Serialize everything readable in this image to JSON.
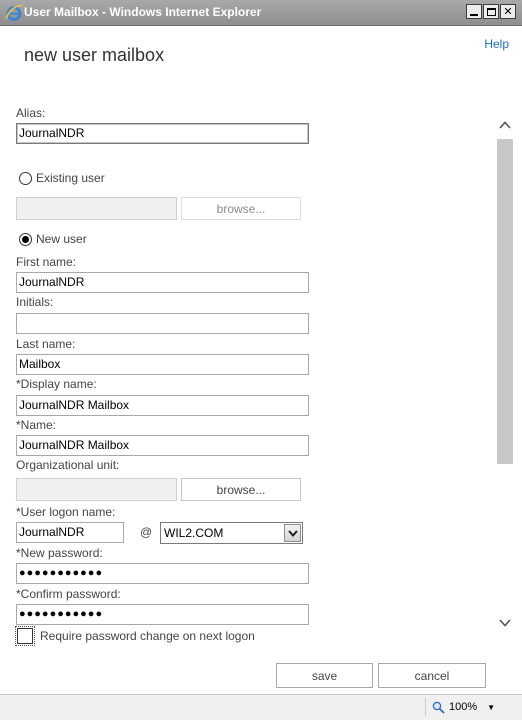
{
  "window": {
    "title": "User Mailbox - Windows Internet Explorer",
    "minimize_glyph": "",
    "close_glyph": "✕"
  },
  "page": {
    "help": "Help",
    "title": "new user mailbox"
  },
  "form": {
    "alias_label": "Alias:",
    "alias_value": "JournalNDR",
    "existing_user_label": "Existing user",
    "existing_browse": "browse...",
    "new_user_label": "New user",
    "selected_option": "New user",
    "first_name_label": "First name:",
    "first_name_value": "JournalNDR",
    "initials_label": "Initials:",
    "initials_value": "",
    "last_name_label": "Last name:",
    "last_name_value": "Mailbox",
    "display_name_label": "*Display name:",
    "display_name_value": "JournalNDR Mailbox",
    "name_label": "*Name:",
    "name_value": "JournalNDR Mailbox",
    "ou_label": "Organizational unit:",
    "ou_value": "",
    "ou_browse": "browse...",
    "logon_label": "*User logon name:",
    "logon_value": "JournalNDR",
    "at_sign": "@",
    "domain_value": "WIL2.COM",
    "new_password_label": "*New password:",
    "new_password_value": "●●●●●●●●●●●",
    "confirm_password_label": "*Confirm password:",
    "confirm_password_value": "●●●●●●●●●●●",
    "require_change_label": "Require password change on next logon",
    "require_change_checked": false
  },
  "actions": {
    "save": "save",
    "cancel": "cancel"
  },
  "statusbar": {
    "zoom": "100%"
  },
  "icons": {
    "browser": "ie-logo-icon",
    "zoom": "magnifier-icon",
    "dropdown": "chevron-down-icon",
    "scroll_up": "chevron-up-icon",
    "scroll_down": "chevron-down-icon"
  },
  "colors": {
    "titlebar": "#9a9a9a",
    "link": "#1b6ac9",
    "disabled_field": "#f1eff1",
    "scroll_thumb": "#c7c7c7"
  }
}
